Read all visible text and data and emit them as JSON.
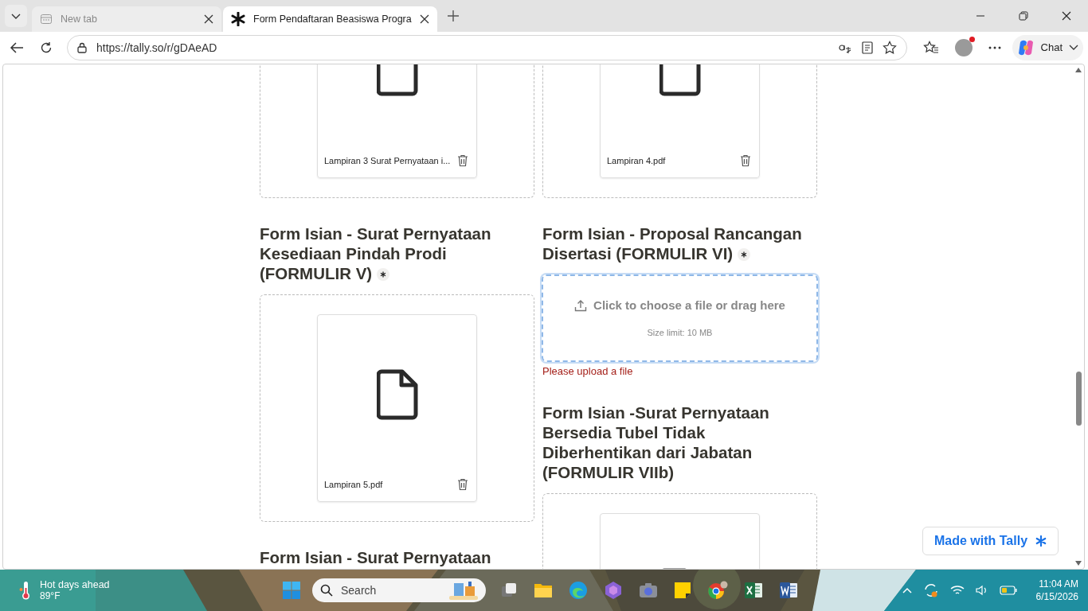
{
  "browser": {
    "tabs": [
      {
        "title": "New tab",
        "selected": false
      },
      {
        "title": "Form Pendaftaran Beasiswa Progra",
        "selected": true
      }
    ],
    "url": "https://tally.so/r/gDAeAD",
    "chat_label": "Chat"
  },
  "form": {
    "columns": [
      [
        {
          "kind": "file_box",
          "filename": "Lampiran 3 Surat Pernyataan i..."
        },
        {
          "kind": "heading",
          "text": "Form Isian - Surat Pernyataan Kesediaan Pindah Prodi (FORMULIR V)",
          "required": true
        },
        {
          "kind": "file_box",
          "filename": "Lampiran 5.pdf"
        },
        {
          "kind": "heading",
          "text": "Form Isian - Surat Pernyataan",
          "required": false
        }
      ],
      [
        {
          "kind": "file_box",
          "filename": "Lampiran 4.pdf"
        },
        {
          "kind": "heading",
          "text": "Form Isian - Proposal Rancangan Disertasi (FORMULIR VI)",
          "required": true
        },
        {
          "kind": "dropzone",
          "prompt": "Click to choose a file or drag here",
          "size_limit": "Size limit: 10 MB",
          "focused": true
        },
        {
          "kind": "error",
          "text": "Please upload a file"
        },
        {
          "kind": "heading",
          "text": "Form Isian -Surat Pernyataan Bersedia Tubel Tidak Diberhentikan dari Jabatan (FORMULIR VIIb)",
          "required": false
        },
        {
          "kind": "file_box"
        }
      ]
    ]
  },
  "badge": "Made with Tally",
  "taskbar": {
    "weather_title": "Hot days ahead",
    "weather_temp": "89°F",
    "search_placeholder": "Search",
    "time": "11:04 AM",
    "date": "6/15/2026"
  }
}
